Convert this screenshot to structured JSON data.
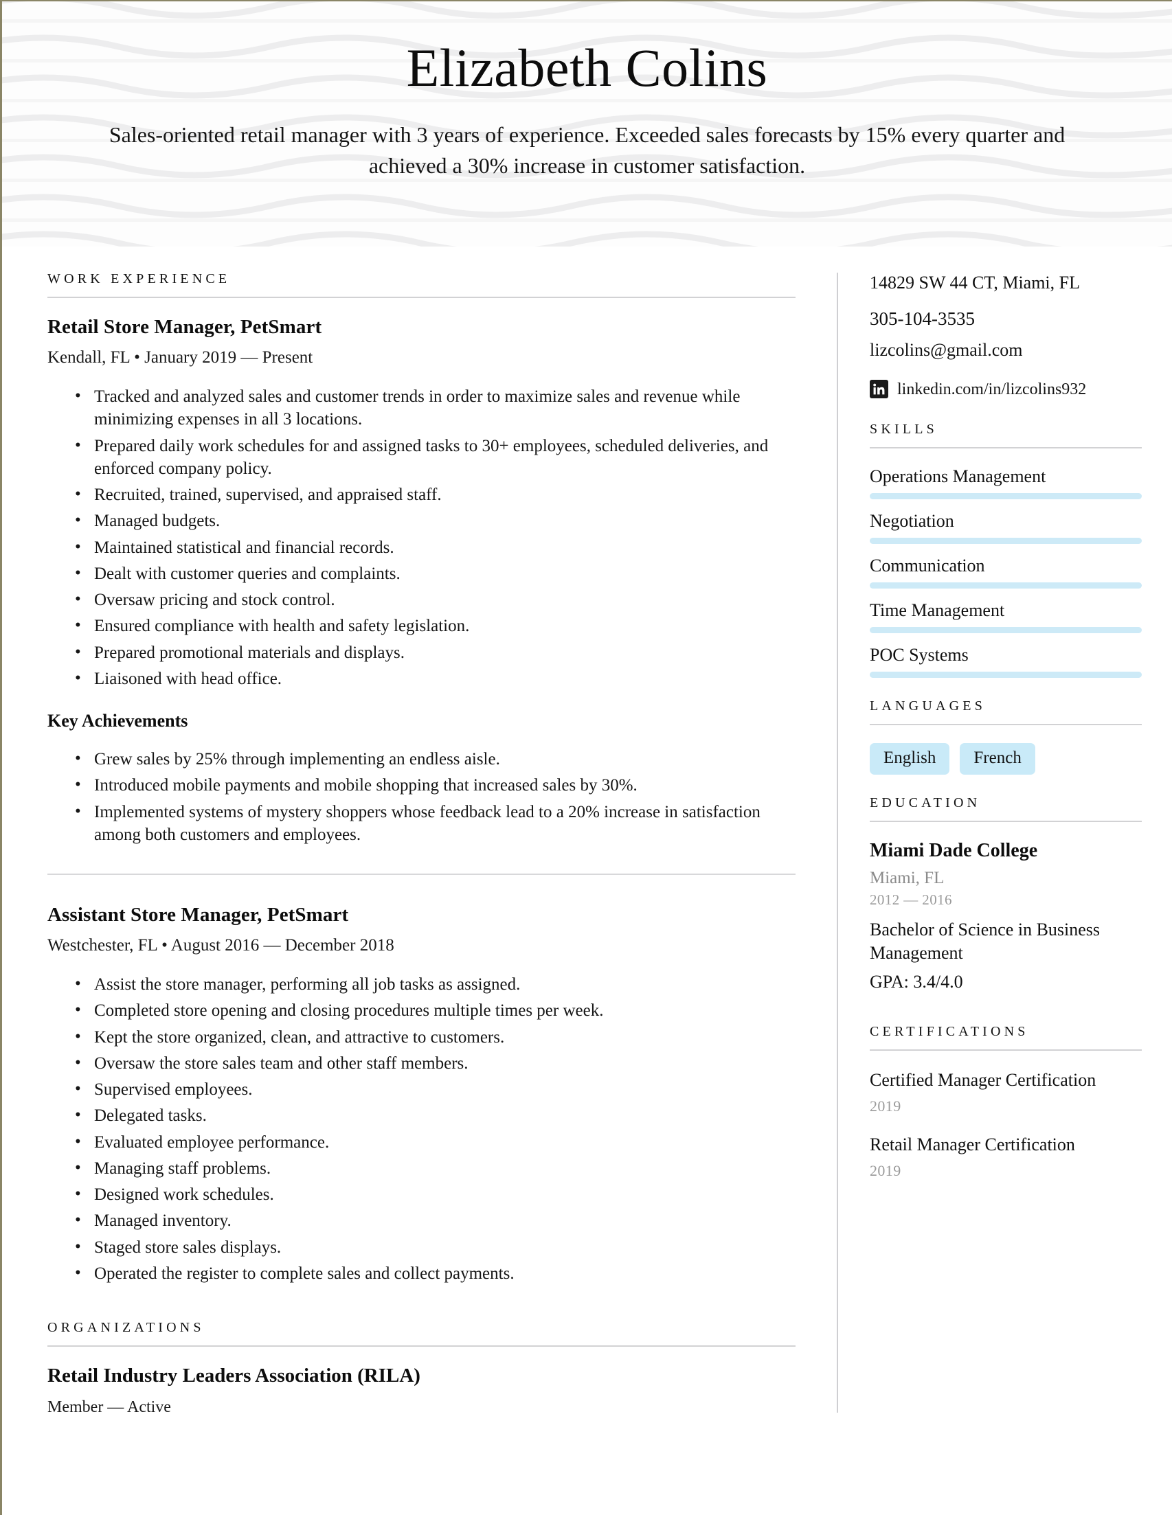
{
  "header": {
    "name": "Elizabeth Colins",
    "tagline": "Sales-oriented retail manager with 3 years of experience. Exceeded sales forecasts by 15% every quarter and achieved a 30% increase in customer satisfaction."
  },
  "colors": {
    "accent_bar": "#cdeaf7",
    "accent_chip": "#c9eaf8",
    "rule": "#d2d2d4",
    "muted_text": "#9a9a9a",
    "page_border": "#8a8566"
  },
  "main": {
    "work_experience": {
      "heading": "WORK EXPERIENCE",
      "jobs": [
        {
          "title": "Retail Store Manager, PetSmart",
          "meta": "Kendall, FL • January 2019 — Present",
          "bullets": [
            "Tracked and analyzed sales and customer trends in order to maximize sales and revenue while minimizing expenses in all 3 locations.",
            "Prepared daily work schedules for and assigned tasks to 30+ employees, scheduled deliveries, and enforced company policy.",
            "Recruited, trained, supervised, and appraised staff.",
            "Managed budgets.",
            "Maintained statistical and financial records.",
            "Dealt with customer queries and complaints.",
            "Oversaw pricing and stock control.",
            "Ensured compliance with health and safety legislation.",
            "Prepared promotional materials and displays.",
            "Liaisoned with head office."
          ],
          "achievements_heading": "Key Achievements",
          "achievements": [
            "Grew sales by 25% through implementing an endless aisle.",
            "Introduced mobile payments and mobile shopping that increased sales by 30%.",
            "Implemented systems of mystery shoppers whose feedback lead to a 20% increase in satisfaction among both customers and employees."
          ]
        },
        {
          "title": "Assistant Store Manager, PetSmart",
          "meta": "Westchester, FL • August 2016 — December 2018",
          "bullets": [
            "Assist the store manager, performing all job tasks as assigned.",
            "Completed store opening and closing procedures multiple times per week.",
            "Kept the store organized, clean, and attractive to customers.",
            "Oversaw the store sales team and other staff members.",
            "Supervised employees.",
            "Delegated tasks.",
            "Evaluated employee performance.",
            "Managing staff problems.",
            "Designed work schedules.",
            "Managed inventory.",
            "Staged store sales displays.",
            "Operated the register to complete sales and collect payments."
          ]
        }
      ]
    },
    "organizations": {
      "heading": "ORGANIZATIONS",
      "items": [
        {
          "name": "Retail Industry Leaders Association (RILA)",
          "meta": "Member — Active"
        }
      ]
    }
  },
  "sidebar": {
    "contact": {
      "address": "14829 SW 44 CT, Miami, FL",
      "phone": "305-104-3535",
      "email": "lizcolins@gmail.com",
      "linkedin": "linkedin.com/in/lizcolins932",
      "linkedin_icon": "linkedin-icon"
    },
    "skills": {
      "heading": "SKILLS",
      "items": [
        {
          "name": "Operations Management",
          "level": 100
        },
        {
          "name": "Negotiation",
          "level": 100
        },
        {
          "name": "Communication",
          "level": 100
        },
        {
          "name": "Time Management",
          "level": 100
        },
        {
          "name": "POC Systems",
          "level": 100
        }
      ]
    },
    "languages": {
      "heading": "LANGUAGES",
      "items": [
        "English",
        "French"
      ]
    },
    "education": {
      "heading": "EDUCATION",
      "school": "Miami Dade College",
      "location": "Miami, FL",
      "years": "2012 — 2016",
      "degree": "Bachelor of Science in Business Management",
      "gpa": "GPA: 3.4/4.0"
    },
    "certifications": {
      "heading": "CERTIFICATIONS",
      "items": [
        {
          "name": "Certified Manager Certification",
          "year": "2019"
        },
        {
          "name": "Retail Manager Certification",
          "year": "2019"
        }
      ]
    }
  }
}
